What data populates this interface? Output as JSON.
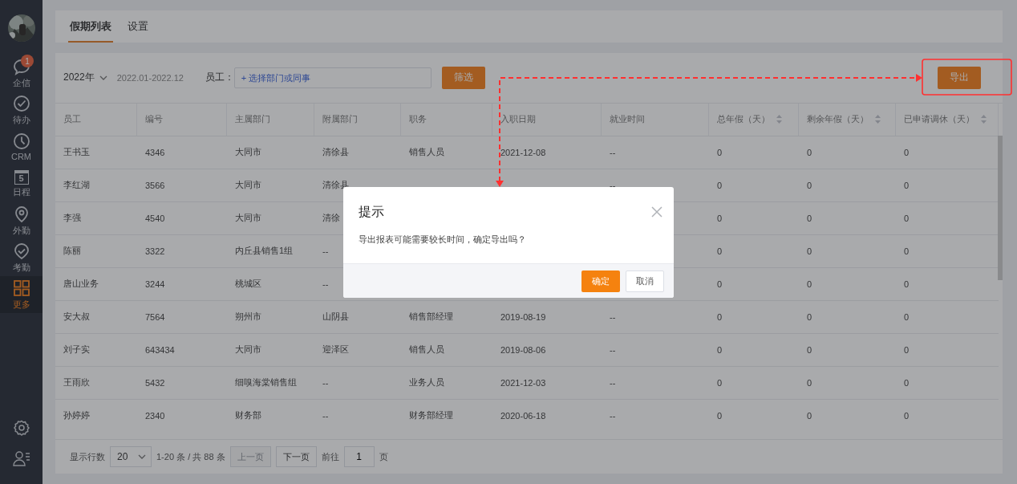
{
  "sidebar": {
    "items": [
      {
        "label": "企信",
        "kind": "chat",
        "badge": "1",
        "selected": false
      },
      {
        "label": "待办",
        "kind": "check",
        "selected": false
      },
      {
        "label": "CRM",
        "kind": "clock",
        "selected": false
      },
      {
        "label": "日程",
        "kind": "calendar",
        "icon_text": "5",
        "selected": false
      },
      {
        "label": "外勤",
        "kind": "pin",
        "selected": false
      },
      {
        "label": "考勤",
        "kind": "shield",
        "selected": false
      },
      {
        "label": "更多",
        "kind": "grid",
        "selected": true
      }
    ],
    "bottom": [
      {
        "kind": "gear"
      },
      {
        "kind": "user-list"
      }
    ]
  },
  "tabs": [
    {
      "label": "假期列表",
      "selected": true
    },
    {
      "label": "设置",
      "selected": false
    }
  ],
  "filter": {
    "year": "2022年",
    "range": "2022.01-2022.12",
    "employee_label": "员工：",
    "employee_placeholder": "+ 选择部门或同事",
    "filter_button": "筛选",
    "export_button": "导出"
  },
  "table": {
    "columns": [
      {
        "label": "员工",
        "sortable": false
      },
      {
        "label": "编号",
        "sortable": false
      },
      {
        "label": "主属部门",
        "sortable": false
      },
      {
        "label": "附属部门",
        "sortable": false
      },
      {
        "label": "职务",
        "sortable": false
      },
      {
        "label": "入职日期",
        "sortable": false
      },
      {
        "label": "就业时间",
        "sortable": false
      },
      {
        "label": "总年假（天）",
        "sortable": true
      },
      {
        "label": "剩余年假（天）",
        "sortable": true
      },
      {
        "label": "已申请调休（天）",
        "sortable": true
      }
    ],
    "rows": [
      [
        "王书玉",
        "4346",
        "大同市",
        "清徐县",
        "销售人员",
        "2021-12-08",
        "--",
        "0",
        "0",
        "0"
      ],
      [
        "李红湖",
        "3566",
        "大同市",
        "清徐县",
        null,
        null,
        "--",
        "0",
        "0",
        "0"
      ],
      [
        "李强",
        "4540",
        "大同市",
        "清徐",
        null,
        null,
        null,
        "0",
        "0",
        "0"
      ],
      [
        "陈丽",
        "3322",
        "内丘县销售1组",
        "--",
        null,
        null,
        null,
        "0",
        "0",
        "0"
      ],
      [
        "唐山业务",
        "3244",
        "桃城区",
        "--",
        null,
        null,
        null,
        "0",
        "0",
        "0"
      ],
      [
        "安大叔",
        "7564",
        "朔州市",
        "山阴县",
        "销售部经理",
        "2019-08-19",
        "--",
        "0",
        "0",
        "0"
      ],
      [
        "刘子实",
        "643434",
        "大同市",
        "迎泽区",
        "销售人员",
        "2019-08-06",
        "--",
        "0",
        "0",
        "0"
      ],
      [
        "王雨欣",
        "5432",
        "细嗅海棠销售组",
        "--",
        "业务人员",
        "2021-12-03",
        "--",
        "0",
        "0",
        "0"
      ],
      [
        "孙婷婷",
        "2340",
        "财务部",
        "--",
        "财务部经理",
        "2020-06-18",
        "--",
        "0",
        "0",
        "0"
      ]
    ]
  },
  "pagination": {
    "rows_label": "显示行数",
    "page_size": "20",
    "summary": "1-20 条 / 共 88 条",
    "prev": "上一页",
    "prev_disabled": true,
    "next": "下一页",
    "next_disabled": false,
    "goto_label": "前往",
    "page": "1",
    "page_suffix": "页"
  },
  "dialog": {
    "title": "提示",
    "message": "导出报表可能需要较长时间，确定导出吗？",
    "confirm": "确定",
    "cancel": "取消"
  }
}
